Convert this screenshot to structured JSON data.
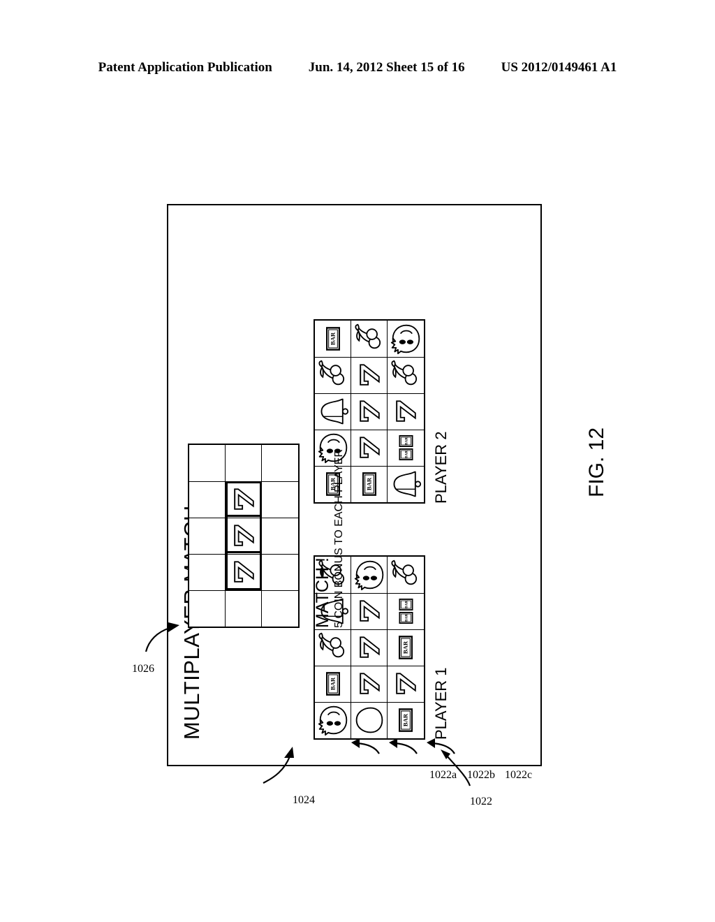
{
  "header": {
    "left": "Patent Application Publication",
    "middle": "Jun. 14, 2012  Sheet 15 of 16",
    "right": "US 2012/0149461 A1"
  },
  "figure": {
    "label": "FIG. 12",
    "title": "MULTIPLAYER MATCH"
  },
  "players": [
    {
      "label": "PLAYER 1",
      "ref": "1022",
      "reel_refs": [
        "1022a",
        "1022b",
        "1022c"
      ],
      "grid": [
        [
          "face",
          "bar",
          "cherry",
          "bell",
          "cherry"
        ],
        [
          "lemon",
          "seven",
          "seven",
          "seven",
          "face"
        ],
        [
          "bar",
          "seven",
          "bar",
          "double-bar",
          "cherry"
        ]
      ]
    },
    {
      "label": "PLAYER 2",
      "ref": "1024",
      "grid": [
        [
          "bar",
          "face",
          "bell",
          "cherry",
          "bar"
        ],
        [
          "bar",
          "seven",
          "seven",
          "seven",
          "cherry"
        ],
        [
          "bell",
          "double-bar",
          "seven",
          "cherry",
          "face"
        ]
      ]
    }
  ],
  "bonus": {
    "ref": "1026",
    "headline": "MATCH !",
    "detail": "5 COIN BONUS TO EACH PLAYER",
    "grid": [
      [
        "",
        "",
        "",
        "",
        ""
      ],
      [
        "",
        "seven",
        "seven",
        "seven",
        ""
      ],
      [
        "",
        "",
        "",
        "",
        ""
      ]
    ],
    "win_line_row": 2,
    "win_line_cols": [
      2,
      3,
      4
    ]
  },
  "symbol_names": {
    "face": "orange-face-icon",
    "bar": "bar-icon",
    "double-bar": "double-bar-icon",
    "cherry": "cherry-icon",
    "bell": "bell-icon",
    "lemon": "lemon-icon",
    "seven": "seven-icon"
  },
  "colors": {
    "ink": "#000000",
    "paper": "#ffffff"
  }
}
